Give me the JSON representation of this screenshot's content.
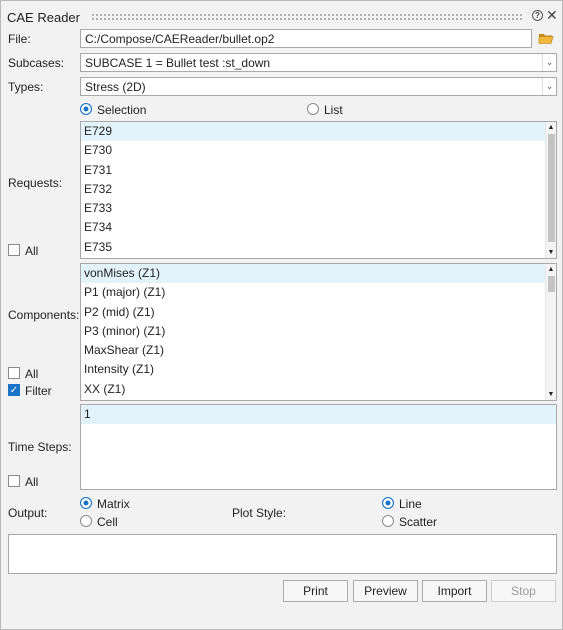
{
  "window": {
    "title": "CAE Reader"
  },
  "file": {
    "label": "File:",
    "value": "C:/Compose/CAEReader/bullet.op2"
  },
  "subcases": {
    "label": "Subcases:",
    "value": "SUBCASE 1 = Bullet test :st_down"
  },
  "types": {
    "label": "Types:",
    "value": "Stress (2D)"
  },
  "mode": {
    "selection_label": "Selection",
    "list_label": "List",
    "selected": "Selection"
  },
  "requests": {
    "label": "Requests:",
    "all_label": "All",
    "items": [
      "E729",
      "E730",
      "E731",
      "E732",
      "E733",
      "E734",
      "E735"
    ]
  },
  "components": {
    "label": "Components:",
    "all_label": "All",
    "filter_label": "Filter",
    "filter_checked": true,
    "items": [
      "vonMises (Z1)",
      "P1 (major) (Z1)",
      "P2 (mid) (Z1)",
      "P3 (minor) (Z1)",
      "MaxShear (Z1)",
      "Intensity (Z1)",
      "XX (Z1)"
    ]
  },
  "time_steps": {
    "label": "Time Steps:",
    "all_label": "All",
    "items": [
      "1"
    ]
  },
  "output": {
    "label": "Output:",
    "matrix_label": "Matrix",
    "cell_label": "Cell",
    "selected": "Matrix"
  },
  "plot_style": {
    "label": "Plot Style:",
    "line_label": "Line",
    "scatter_label": "Scatter",
    "selected": "Line"
  },
  "buttons": {
    "print": "Print",
    "preview": "Preview",
    "import": "Import",
    "stop": "Stop"
  },
  "colors": {
    "accent": "#1a73c7",
    "selection": "#e3f3fb"
  }
}
